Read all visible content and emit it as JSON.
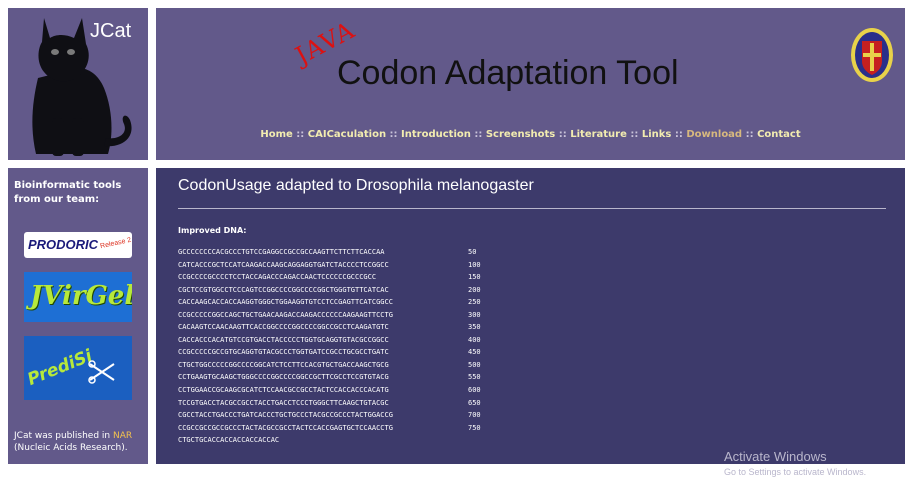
{
  "logo": {
    "text": "JCat"
  },
  "header": {
    "java": "JAVA",
    "title": "Codon Adaptation Tool",
    "seal_icon": "university-seal-icon"
  },
  "nav": [
    {
      "label": "Home"
    },
    {
      "label": "CAICaculation"
    },
    {
      "label": "Introduction"
    },
    {
      "label": "Screenshots"
    },
    {
      "label": "Literature"
    },
    {
      "label": "Links"
    },
    {
      "label": "Download"
    },
    {
      "label": "Contact"
    }
  ],
  "nav_separator": " :: ",
  "sidebar": {
    "heading": "Bioinformatic tools from our team:",
    "banners": {
      "prodoric": {
        "name": "PRODORIC",
        "tag": "Release 2"
      },
      "jvirgel": {
        "name": "JVirGel"
      },
      "predisi": {
        "name": "PrediSi"
      }
    },
    "note_pre": "JCat was published in ",
    "note_link": "NAR",
    "note_post": " (Nucleic Acids Research)."
  },
  "main": {
    "title": "CodonUsage adapted to Drosophila melanogaster",
    "dna_label": "Improved DNA:",
    "sequence": [
      {
        "seq": "GCCCCCCCCACGCCCTGTCCGAGGCCGCCGCCAAGTTCTTCTTCACCAA",
        "num": "50"
      },
      {
        "seq": "CATCACCCGCTCCATCAAGACCAAGCAGGAGGTGATCTACCCCTCCGGCC",
        "num": "100"
      },
      {
        "seq": "CCGCCCCGCCCCTCCTACCAGACCCAGACCAACTCCCCCCGCCCGCC",
        "num": "150"
      },
      {
        "seq": "CGCTCCGTGGCCTCCCAGTCCGGCCCCGGCCCCGGCTGGGTGTTCATCAC",
        "num": "200"
      },
      {
        "seq": "CACCAAGCACCACCAAGGTGGGCTGGAAGGTGTCCTCCGAGTTCATCGGCC",
        "num": "250"
      },
      {
        "seq": "CCGCCCCCGGCCAGCTGCTGAACAAGACCAAGACCCCCCAAGAAGTTCCTG",
        "num": "300"
      },
      {
        "seq": "CACAAGTCCAACAAGTTCACCGGCCCCGGCCCCGGCCGCCTCAAGATGTC",
        "num": "350"
      },
      {
        "seq": "CACCACCCACATGTCCGTGACCTACCCCCTGGTGCAGGTGTACGCCGGCC",
        "num": "400"
      },
      {
        "seq": "CCGCCCCCGCCGTGCAGGTGTACGCCCTGGTGATCCGCCTGCGCCTGATC",
        "num": "450"
      },
      {
        "seq": "CTGCTGGCCCCCGGCCCCGGCATCTCCTTCCACGTGCTGACCAAGCTGCG",
        "num": "500"
      },
      {
        "seq": "CCTGAAGTGCAAGCTGGGCCCCGGCCCCGGCCGCTTCGCCTCCGTGTACG",
        "num": "550"
      },
      {
        "seq": "CCTGGAACCGCAAGCGCATCTCCAACGCCGCCTACTCCACCACCCACATG",
        "num": "600"
      },
      {
        "seq": "TCCGTGACCTACGCCGCCTACCTGACCTCCCTGGGCTTCAAGCTGTACGC",
        "num": "650"
      },
      {
        "seq": "CGCCTACCTGACCCTGATCACCCTGCTGCCCTACGCCGCCCTACTGGACCG",
        "num": "700"
      },
      {
        "seq": "CCGCCGCCGCCGCCCTACTACGCCGCCTACTCCACCGAGTGCTCCAACCTG",
        "num": "750"
      },
      {
        "seq": "CTGCTGCACCACCACCACCACCAC",
        "num": ""
      }
    ]
  },
  "watermark": {
    "line1": "Activate Windows",
    "line2": "Go to Settings to activate Windows."
  },
  "colors": {
    "panel": "#62598a",
    "main": "#3d3a6b",
    "nav_link": "#f2ecb0",
    "java": "#dd1111"
  }
}
